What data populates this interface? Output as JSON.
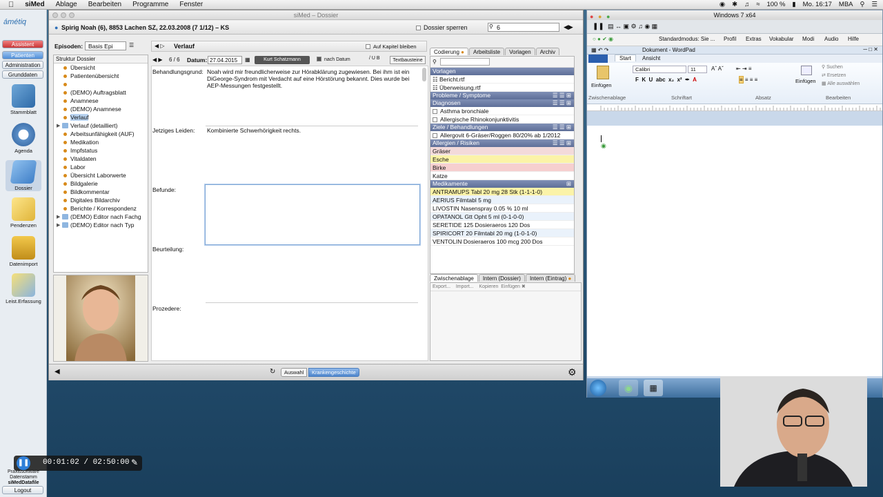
{
  "menubar": {
    "app_name": "siMed",
    "items": [
      "Ablage",
      "Bearbeiten",
      "Programme",
      "Fenster"
    ],
    "battery": "100 %",
    "clock": "Mo. 16:17",
    "user": "MBA"
  },
  "sidebar": {
    "logo": "ámétiq",
    "buttons": [
      "Assistent",
      "Patienten",
      "Administration",
      "Grunddaten"
    ],
    "icons": [
      "Stammblatt",
      "Agenda",
      "Dossier",
      "Pendenzen",
      "Datenimport",
      "Leist.Erfassung"
    ],
    "footer": [
      "Praxissoftware",
      "Datenstamm",
      "siMedDatafile",
      "Logout"
    ]
  },
  "simed": {
    "window_title": "siMed – Dossier",
    "patient": "Spirig Noah (6), 8853 Lachen SZ, 22.03.2008 (7 1/12) – KS",
    "dossier_lock": "Dossier sperren",
    "search_value": "6",
    "episodes_label": "Episoden:",
    "episodes_value": "Basis Epi",
    "tree_header": "Struktur Dossier",
    "tree": [
      {
        "label": "Übersicht",
        "fold": false
      },
      {
        "label": "Patientenübersicht",
        "fold": false
      },
      {
        "label": "",
        "fold": false
      },
      {
        "label": "(DEMO) Auftragsblatt",
        "fold": false
      },
      {
        "label": "Anamnese",
        "fold": false
      },
      {
        "label": "(DEMO) Anamnese",
        "fold": false
      },
      {
        "label": "Verlauf",
        "fold": false,
        "selected": true
      },
      {
        "label": "Verlauf (detailliert)",
        "fold": true
      },
      {
        "label": "Arbeitsunfähigkeit (AUF)",
        "fold": false
      },
      {
        "label": "Medikation",
        "fold": false
      },
      {
        "label": "Impfstatus",
        "fold": false
      },
      {
        "label": "Vitaldaten",
        "fold": false
      },
      {
        "label": "Labor",
        "fold": false
      },
      {
        "label": "Übersicht Laborwerte",
        "fold": false
      },
      {
        "label": "Bildgalerie",
        "fold": false
      },
      {
        "label": "Bildkommentar",
        "fold": false
      },
      {
        "label": "Digitales Bildarchiv",
        "fold": false
      },
      {
        "label": "Berichte / Korrespondenz",
        "fold": false
      },
      {
        "label": "(DEMO) Editor nach Fachg",
        "fold": true
      },
      {
        "label": "(DEMO) Editor nach Typ",
        "fold": true
      }
    ],
    "center_title": "Verlauf",
    "keep_chapter": "Auf Kapitel bleiben",
    "counter": "6 / 6",
    "date_label": "Datum:",
    "date_value": "27.04.2015",
    "doctor": "Kurt Schatzmann",
    "after_date": "nach Datum",
    "text_blocks": "Textbausteine",
    "fields": {
      "reason_label": "Behandlungsgrund:",
      "reason_text": "Noah wird mir freundlicherweise zur Hörabklärung zugewiesen. Bei ihm ist ein DiGeorge-Syndrom mit Verdacht auf eine Hörstörung bekannt. Dies wurde bei AEP-Messungen festgestellt.",
      "current_label": "Jetziges Leiden:",
      "current_text": "Kombinierte Schwerhörigkeit rechts.",
      "findings_label": "Befunde:",
      "assessment_label": "Beurteilung:",
      "procedure_label": "Prozedere:"
    },
    "right_tabs": [
      "Codierung",
      "Arbeitsliste",
      "Vorlagen",
      "Archiv"
    ],
    "templates_header": "Vorlagen",
    "templates": [
      "Bericht.rtf",
      "Überweisung.rtf"
    ],
    "problems_header": "Probleme / Symptome",
    "diagnoses_header": "Diagnosen",
    "diagnoses": [
      "Asthma bronchiale",
      "Allergische Rhinokonjunktivitis"
    ],
    "goals_header": "Ziele / Behandlungen",
    "goals": [
      "Allergovit 6-Gräser/Roggen 80/20% ab 1/2012"
    ],
    "allergies_header": "Allergien / Risiken",
    "allergies": [
      {
        "label": "Gräser",
        "color": "#f3dada"
      },
      {
        "label": "Esche",
        "color": "#fbf3a8"
      },
      {
        "label": "Birke",
        "color": "#f6cfcf"
      },
      {
        "label": "Katze",
        "color": "#ffffff"
      }
    ],
    "meds_header": "Medikamente",
    "meds": [
      {
        "label": "ANTRAMUPS Tabl 20 mg 28 Stk (1-1-1-0)",
        "color": "#fbf3a8"
      },
      {
        "label": "AERIUS Filmtabl 5 mg",
        "color": "#eaf2fb"
      },
      {
        "label": "LIVOSTIN Nasenspray 0.05 % 10 ml",
        "color": "#ffffff"
      },
      {
        "label": "OPATANOL Gtt Opht 5 ml (0-1-0-0)",
        "color": "#eaf2fb"
      },
      {
        "label": "SERETIDE 125 Dosieraeros 120 Dos",
        "color": "#ffffff"
      },
      {
        "label": "SPIRICORT 20 Filmtabl 20 mg (1-0-1-0)",
        "color": "#eaf2fb"
      },
      {
        "label": "VENTOLIN Dosieraeros 100 mcg 200 Dos",
        "color": "#ffffff"
      }
    ],
    "bottom_tabs": [
      "Zwischenablage",
      "Intern (Dossier)",
      "Intern (Eintrag)"
    ],
    "bottom_buttons": [
      "Export...",
      "Import...",
      "Kopieren",
      "Einfügen"
    ],
    "footer_buttons": [
      "Auswahl",
      "Krankengeschichte"
    ]
  },
  "vm": {
    "title": "Windows 7 x64",
    "toolbar_mode": "Standardmodus: Sie ...",
    "menu": [
      "Profil",
      "Extras",
      "Vokabular",
      "Modi",
      "Audio",
      "Hilfe"
    ],
    "wordpad_title": "Dokument - WordPad",
    "ribbon_tabs": [
      "Start",
      "Ansicht"
    ],
    "paste": "Einfügen",
    "font": "Calibri",
    "font_size": "11",
    "insert": "Einfügen",
    "search": "Suchen",
    "replace": "Ersetzen",
    "select_all": "Alle auswählen",
    "groups": [
      "Zwischenablage",
      "Schriftart",
      "Absatz",
      "Bearbeiten"
    ]
  },
  "recorder": {
    "time": "00:01:02 / 02:50:00"
  },
  "colors": {
    "header_blue": "#6a7aa3",
    "selection": "#b9d3f0",
    "accent_orange": "#d88a1a"
  }
}
